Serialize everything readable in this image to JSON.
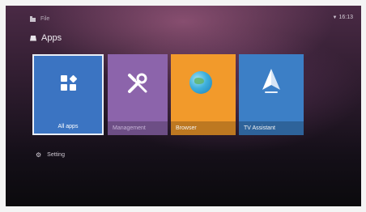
{
  "nav": {
    "file_label": "File"
  },
  "status": {
    "wifi_icon": "wifi-icon",
    "time": "16:13"
  },
  "section": {
    "title": "Apps",
    "icon": "shopping-bag-icon"
  },
  "tiles": [
    {
      "label": "All apps",
      "icon": "all-apps-grid-icon",
      "color": "#3b74c2",
      "selected": true
    },
    {
      "label": "Management",
      "icon": "tools-icon",
      "color": "#8c64ab"
    },
    {
      "label": "Browser",
      "icon": "globe-icon",
      "color": "#f29a2b"
    },
    {
      "label": "TV Assistant",
      "icon": "sailboat-icon",
      "color": "#3c7fc6"
    }
  ],
  "setting": {
    "label": "Setting",
    "icon": "gear-icon"
  }
}
